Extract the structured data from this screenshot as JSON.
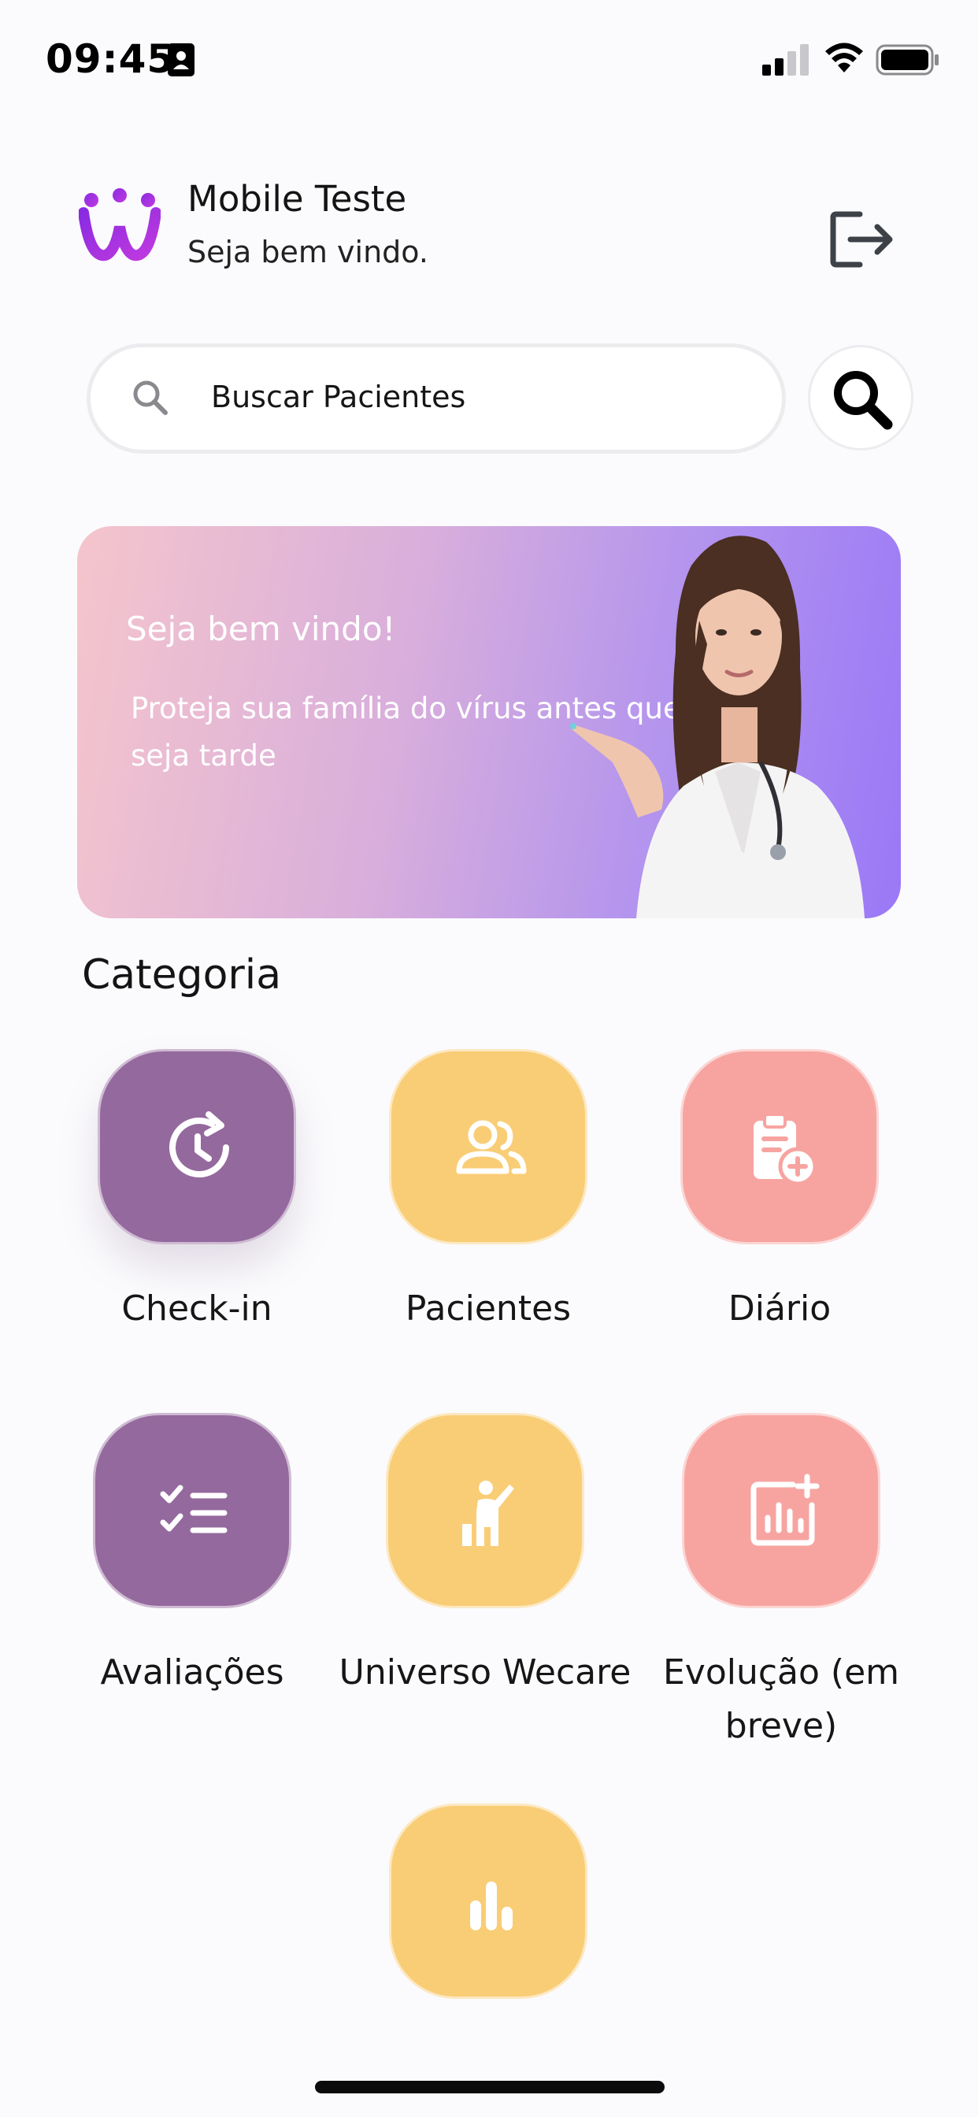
{
  "status_bar": {
    "time": "09:45",
    "icons": [
      "contact-card-icon",
      "cellular-signal-icon",
      "wifi-icon",
      "battery-icon"
    ]
  },
  "header": {
    "user_name": "Mobile Teste",
    "greeting": "Seja bem vindo.",
    "logo_icon": "wecare-logo-icon",
    "logout_icon": "logout-icon"
  },
  "search": {
    "placeholder": "Buscar Pacientes",
    "icon": "search-icon",
    "button_icon": "search-icon"
  },
  "banner": {
    "title": "Seja bem vindo!",
    "text": "Proteja sua família do vírus antes que seja tarde"
  },
  "category": {
    "title": "Categoria",
    "items": [
      {
        "label": "Check-in",
        "icon": "clock-refresh-icon",
        "color": "#94699d"
      },
      {
        "label": "Pacientes",
        "icon": "users-icon",
        "color": "#f9cd76"
      },
      {
        "label": "Diário",
        "icon": "clipboard-plus-icon",
        "color": "#f7a4a1"
      },
      {
        "label": "Avaliações",
        "icon": "checklist-icon",
        "color": "#94699d"
      },
      {
        "label": "Universo Wecare",
        "icon": "person-achievement-icon",
        "color": "#f9cd76"
      },
      {
        "label": "Evolução (em breve)",
        "icon": "chart-plus-icon",
        "color": "#f7a4a1"
      },
      {
        "label": "",
        "icon": "bar-chart-icon",
        "color": "#f9cd76"
      }
    ]
  },
  "colors": {
    "background": "#fbfbfd",
    "purple": "#94699d",
    "yellow": "#f9cd76",
    "pink": "#f7a4a1",
    "banner_gradient_start": "#f5c5cc",
    "banner_gradient_end": "#9a78f7"
  }
}
